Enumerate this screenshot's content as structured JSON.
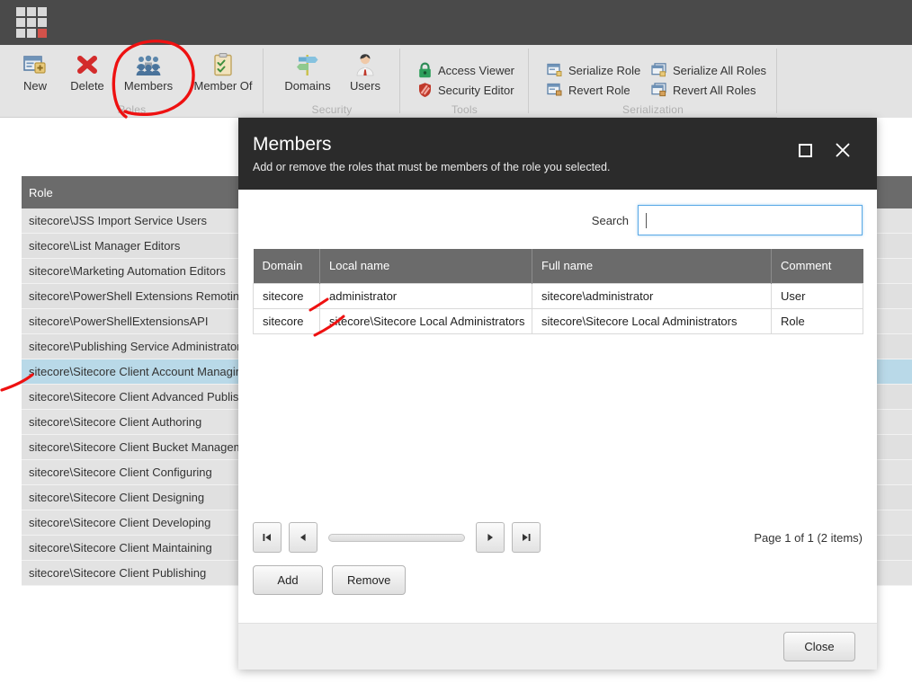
{
  "app": {
    "logo_name": "sitecore-logo",
    "logo_accent_color": "#d3524a"
  },
  "ribbon": {
    "groups": [
      {
        "name": "roles",
        "title": "Roles",
        "buttons": [
          {
            "label": "New",
            "icon": "new-role-icon"
          },
          {
            "label": "Delete",
            "icon": "delete-icon"
          },
          {
            "label": "Members",
            "icon": "members-icon"
          },
          {
            "label": "Member Of",
            "icon": "member-of-icon"
          }
        ]
      },
      {
        "name": "security",
        "title": "Security",
        "buttons": [
          {
            "label": "Domains",
            "icon": "domains-icon"
          },
          {
            "label": "Users",
            "icon": "users-icon"
          }
        ]
      },
      {
        "name": "tools",
        "title": "Tools",
        "buttons": [
          {
            "label": "Access Viewer",
            "icon": "lock-icon"
          },
          {
            "label": "Security Editor",
            "icon": "shield-icon"
          }
        ]
      },
      {
        "name": "serialization",
        "title": "Serialization",
        "buttons": [
          {
            "label": "Serialize Role",
            "icon": "serialize-icon"
          },
          {
            "label": "Revert Role",
            "icon": "revert-icon"
          },
          {
            "label": "Serialize All Roles",
            "icon": "serialize-all-icon"
          },
          {
            "label": "Revert All Roles",
            "icon": "revert-all-icon"
          }
        ]
      }
    ]
  },
  "roles_grid": {
    "header": "Role",
    "selected_index": 6,
    "rows": [
      "sitecore\\JSS Import Service Users",
      "sitecore\\List Manager Editors",
      "sitecore\\Marketing Automation Editors",
      "sitecore\\PowerShell Extensions Remoting",
      "sitecore\\PowerShellExtensionsAPI",
      "sitecore\\Publishing Service Administrator",
      "sitecore\\Sitecore Client Account Managing",
      "sitecore\\Sitecore Client Advanced Publishing",
      "sitecore\\Sitecore Client Authoring",
      "sitecore\\Sitecore Client Bucket Management",
      "sitecore\\Sitecore Client Configuring",
      "sitecore\\Sitecore Client Designing",
      "sitecore\\Sitecore Client Developing",
      "sitecore\\Sitecore Client Maintaining",
      "sitecore\\Sitecore Client Publishing"
    ]
  },
  "dialog": {
    "title": "Members",
    "subtitle": "Add or remove the roles that must be members of the role you selected.",
    "maximize_label": "maximize",
    "close_label": "close",
    "search": {
      "label": "Search",
      "value": "",
      "placeholder": ""
    },
    "table": {
      "columns": [
        "Domain",
        "Local name",
        "Full name",
        "Comment"
      ],
      "rows": [
        [
          "sitecore",
          "administrator",
          "sitecore\\administrator",
          "User"
        ],
        [
          "sitecore",
          "sitecore\\Sitecore Local Administrators",
          "sitecore\\Sitecore Local Administrators",
          "Role"
        ]
      ]
    },
    "pager": {
      "first_label": "⏮",
      "prev_label": "◀",
      "next_label": "▶",
      "last_label": "⏭",
      "info": "Page 1 of 1 (2 items)"
    },
    "add_label": "Add",
    "remove_label": "Remove",
    "close_button_label": "Close"
  },
  "annotations": {
    "circle_target": "members-button",
    "ink_color": "#ee1111"
  }
}
